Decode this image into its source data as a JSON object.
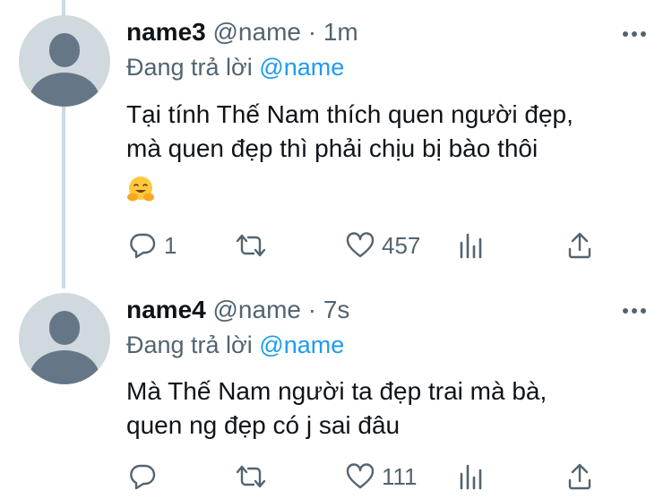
{
  "tweets": [
    {
      "display_name": "name3",
      "handle": "@name",
      "separator": "·",
      "time": "1m",
      "reply_prefix": "Đang trả lời",
      "reply_mention": "@name",
      "text_lines": [
        "Tại tính Thế Nam thích quen người đẹp,",
        "mà quen đẹp thì phải chịu bị bào thôi"
      ],
      "emoji": "hugging-face-emoji",
      "reply_count": "1",
      "retweet_count": "",
      "like_count": "457"
    },
    {
      "display_name": "name4",
      "handle": "@name",
      "separator": "·",
      "time": "7s",
      "reply_prefix": "Đang trả lời",
      "reply_mention": "@name",
      "text_lines": [
        "Mà Thế Nam người ta đẹp trai mà bà,",
        "quen ng đẹp có j sai đâu"
      ],
      "reply_count": "",
      "retweet_count": "",
      "like_count": "111"
    }
  ],
  "icons": {
    "reply": "reply-icon",
    "retweet": "retweet-icon",
    "like": "like-icon",
    "analytics": "analytics-icon",
    "share": "share-icon",
    "more": "more-icon"
  },
  "colors": {
    "text": "#0f1419",
    "secondary": "#536471",
    "mention": "#1d9bf0",
    "avatar_bg": "#cfd9de",
    "avatar_fg": "#657786",
    "thread_line": "#cfd9de"
  }
}
